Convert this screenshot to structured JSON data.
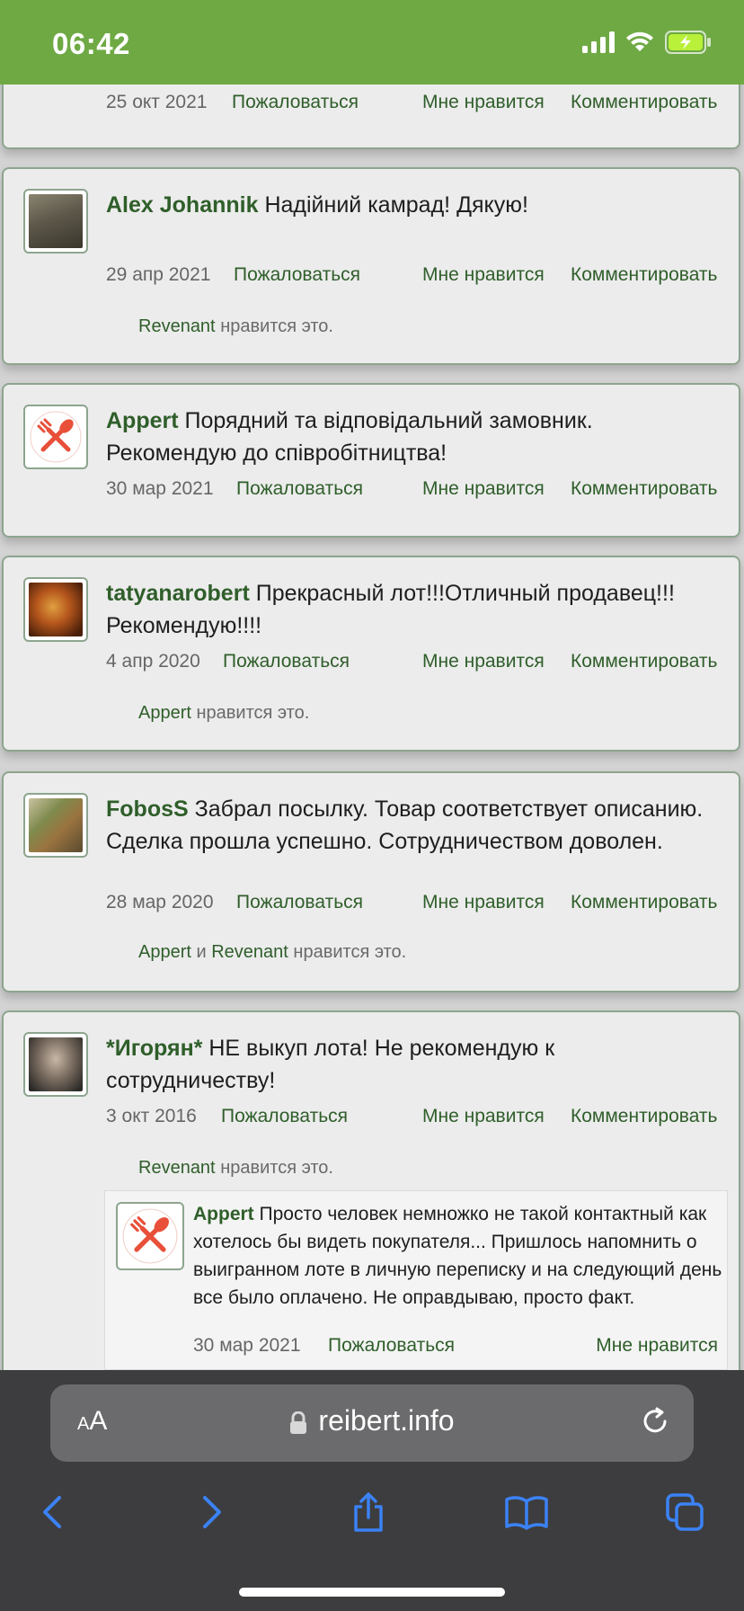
{
  "status_bar": {
    "time": "06:42",
    "battery_charging": true
  },
  "common": {
    "report_label": "Пожаловаться",
    "like_label": "Мне нравится",
    "comment_label": "Комментировать",
    "likes_suffix": "нравится это.",
    "and_word": "и"
  },
  "posts": [
    {
      "date": "25 окт 2021"
    },
    {
      "author": "Alex Johannik",
      "text": "Надійний камрад! Дякую!",
      "date": "29 апр 2021",
      "liked_by": [
        "Revenant"
      ]
    },
    {
      "author": "Appert",
      "text": "Порядний та відповідальний замовник. Рекомендую до співробітництва!",
      "date": "30 мар 2021"
    },
    {
      "author": "tatyanarobert",
      "text": "Прекрасный лот!!!Отличный продавец!!! Рекомендую!!!!",
      "date": "4 апр 2020",
      "liked_by": [
        "Appert"
      ]
    },
    {
      "author": "FobosS",
      "text": "Забрал посылку. Товар соответствует описанию. Сделка прошла успешно. Сотрудничеством доволен.",
      "date": "28 мар 2020",
      "liked_by": [
        "Appert",
        "Revenant"
      ]
    },
    {
      "author": "*Игорян*",
      "text": "НЕ выкуп лота! Не рекомендую к сотрудничеству!",
      "date": "3 окт 2016",
      "liked_by": [
        "Revenant"
      ],
      "reply": {
        "author": "Appert",
        "text": "Просто человек немножко не такой контактный как хотелось бы видеть покупателя... Пришлось напомнить о выигранном лоте в личную переписку и на следующий день все было оплачено. Не оправдываю, просто факт.",
        "date": "30 мар 2021"
      }
    }
  ],
  "browser": {
    "text_size_label_small": "A",
    "text_size_label_large": "A",
    "url": "reibert.info"
  },
  "colors": {
    "brand_green": "#6fa944",
    "link_green": "#2f5e2a",
    "card_bg": "#ececec"
  },
  "icons": [
    "signal-icon",
    "wifi-icon",
    "battery-icon",
    "lock-icon",
    "reload-icon",
    "back-icon",
    "forward-icon",
    "share-icon",
    "bookmarks-icon",
    "tabs-icon",
    "fork-knife-icon"
  ]
}
